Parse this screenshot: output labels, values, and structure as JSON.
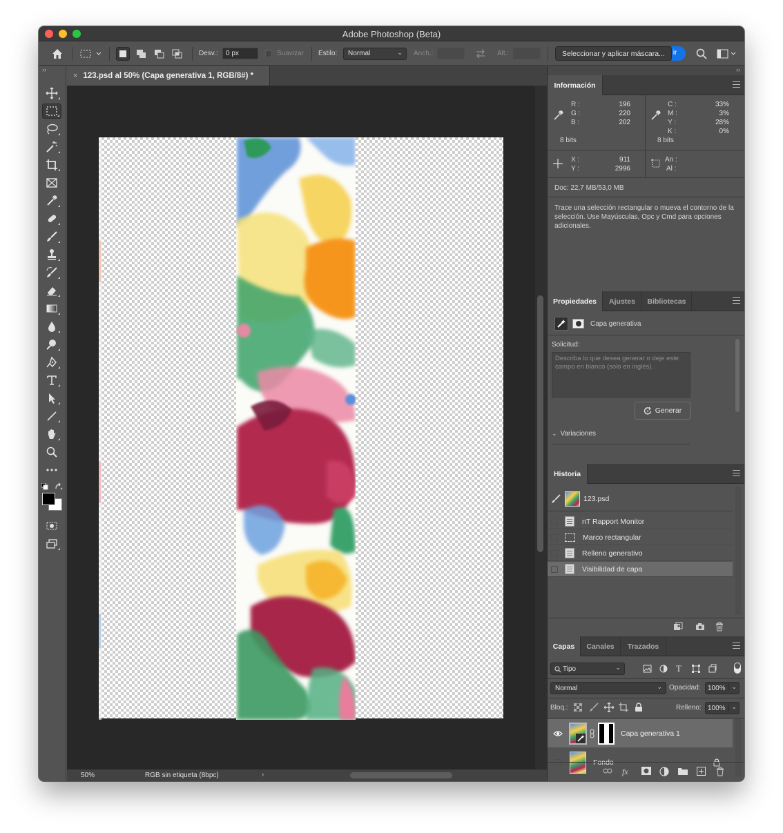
{
  "window": {
    "title": "Adobe Photoshop (Beta)"
  },
  "options_bar": {
    "feather_label": "Desv.:",
    "feather_value": "0 px",
    "antialias_label": "Suavizar",
    "style_label": "Estilo:",
    "style_value": "Normal",
    "width_label": "Anch.:",
    "height_label": "Alt.:",
    "mask_button": "Seleccionar y aplicar máscara...",
    "mask_button_suffix": "ir"
  },
  "document": {
    "tab_title": "123.psd al 50% (Capa generativa 1, RGB/8#) *",
    "close_glyph": "×"
  },
  "status_bar": {
    "zoom": "50%",
    "profile": "RGB sin etiqueta (8bpc)",
    "arrow": "›"
  },
  "info_panel": {
    "tab": "Información",
    "rgb": {
      "r_label": "R :",
      "g_label": "G :",
      "b_label": "B :",
      "r": "196",
      "g": "220",
      "b": "202",
      "bits": "8 bits"
    },
    "cmyk": {
      "c_label": "C :",
      "m_label": "M :",
      "y_label": "Y :",
      "k_label": "K :",
      "c": "33%",
      "m": "3%",
      "y": "28%",
      "k": "0%",
      "bits": "8 bits"
    },
    "xy": {
      "x_label": "X :",
      "y_label": "Y :",
      "x": "911",
      "y": "2996"
    },
    "size": {
      "w_label": "An :",
      "h_label": "Al :"
    },
    "doc": "Doc: 22,7 MB/53,0 MB",
    "hint": "Trace una selección rectangular o mueva el contorno de la selección. Use Mayúsculas, Opc y Cmd para opciones adicionales."
  },
  "properties_panel": {
    "tabs": [
      "Propiedades",
      "Ajustes",
      "Bibliotecas"
    ],
    "layer_kind": "Capa generativa",
    "prompt_label": "Solicitud:",
    "prompt_placeholder": "Describa lo que desea generar o deje este campo en blanco (solo en inglés).",
    "generate_button": "Generar",
    "variations_label": "Variaciones"
  },
  "history_panel": {
    "tab": "Historia",
    "snapshot": "123.psd",
    "steps": [
      "nT Rapport Monitor",
      "Marco rectangular",
      "Relleno generativo",
      "Visibilidad de capa"
    ]
  },
  "layers_panel": {
    "tabs": [
      "Capas",
      "Canales",
      "Trazados"
    ],
    "filter_value": "Tipo",
    "blend_mode": "Normal",
    "opacity_label": "Opacidad:",
    "opacity_value": "100%",
    "lock_label": "Bloq.:",
    "fill_label": "Relleno:",
    "fill_value": "100%",
    "layers": [
      {
        "name": "Capa generativa 1",
        "visible": true,
        "selected": true
      },
      {
        "name": "Fondo",
        "visible": false,
        "locked": true
      }
    ]
  },
  "colors": {
    "accent_blue": "#1473e6",
    "panel_bg": "#535353",
    "canvas_bg": "#282828",
    "selection_row": "#6b6b6b"
  }
}
